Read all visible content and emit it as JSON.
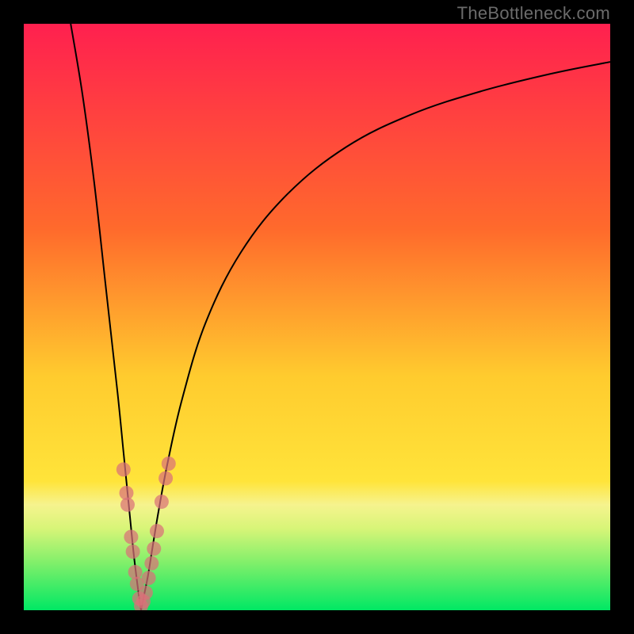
{
  "watermark": "TheBottleneck.com",
  "colors": {
    "green": "#00e864",
    "yellow": "#ffe43a",
    "orange": "#ff8c2b",
    "red": "#ff204f",
    "marker": "#d97079",
    "curve": "#000000",
    "page_bg": "#000000"
  },
  "gradient_stops": [
    {
      "pct": 0,
      "color": "#ff204f"
    },
    {
      "pct": 35,
      "color": "#ff6a2c"
    },
    {
      "pct": 60,
      "color": "#ffcb2e"
    },
    {
      "pct": 78,
      "color": "#ffe43a"
    },
    {
      "pct": 82,
      "color": "#f6f38e"
    },
    {
      "pct": 86,
      "color": "#d8f578"
    },
    {
      "pct": 92,
      "color": "#7fef6a"
    },
    {
      "pct": 100,
      "color": "#00e864"
    }
  ],
  "chart_data": {
    "type": "line",
    "title": "",
    "xlabel": "",
    "ylabel": "",
    "xlim": [
      0,
      100
    ],
    "ylim": [
      0,
      100
    ],
    "grid": false,
    "legend": false,
    "series": [
      {
        "name": "left-branch",
        "color": "#000000",
        "x": [
          8,
          10,
          12,
          14,
          16,
          17,
          18,
          18.7,
          19.3,
          19.7,
          20.0
        ],
        "values": [
          100,
          88,
          73,
          55,
          37,
          27,
          17,
          10,
          5,
          2,
          0
        ]
      },
      {
        "name": "right-branch",
        "color": "#000000",
        "x": [
          20.0,
          20.5,
          21.2,
          22,
          23,
          24.5,
          27,
          31,
          37,
          45,
          55,
          66,
          78,
          90,
          100
        ],
        "values": [
          0,
          2.5,
          6,
          11,
          17,
          25,
          36,
          49,
          61,
          71,
          79,
          84.5,
          88.5,
          91.5,
          93.5
        ]
      }
    ],
    "highlight_points_left": [
      {
        "x": 17.0,
        "y": 24.0
      },
      {
        "x": 17.5,
        "y": 20.0
      },
      {
        "x": 17.7,
        "y": 18.0
      },
      {
        "x": 18.3,
        "y": 12.5
      },
      {
        "x": 18.6,
        "y": 10.0
      },
      {
        "x": 19.0,
        "y": 6.5
      },
      {
        "x": 19.3,
        "y": 4.5
      },
      {
        "x": 19.7,
        "y": 2.0
      },
      {
        "x": 20.0,
        "y": 0.7
      }
    ],
    "highlight_points_right": [
      {
        "x": 20.4,
        "y": 1.5
      },
      {
        "x": 20.8,
        "y": 3.0
      },
      {
        "x": 21.3,
        "y": 5.5
      },
      {
        "x": 21.8,
        "y": 8.0
      },
      {
        "x": 22.2,
        "y": 10.5
      },
      {
        "x": 22.7,
        "y": 13.5
      },
      {
        "x": 23.5,
        "y": 18.5
      },
      {
        "x": 24.2,
        "y": 22.5
      },
      {
        "x": 24.7,
        "y": 25.0
      }
    ],
    "marker_radius": 9
  }
}
